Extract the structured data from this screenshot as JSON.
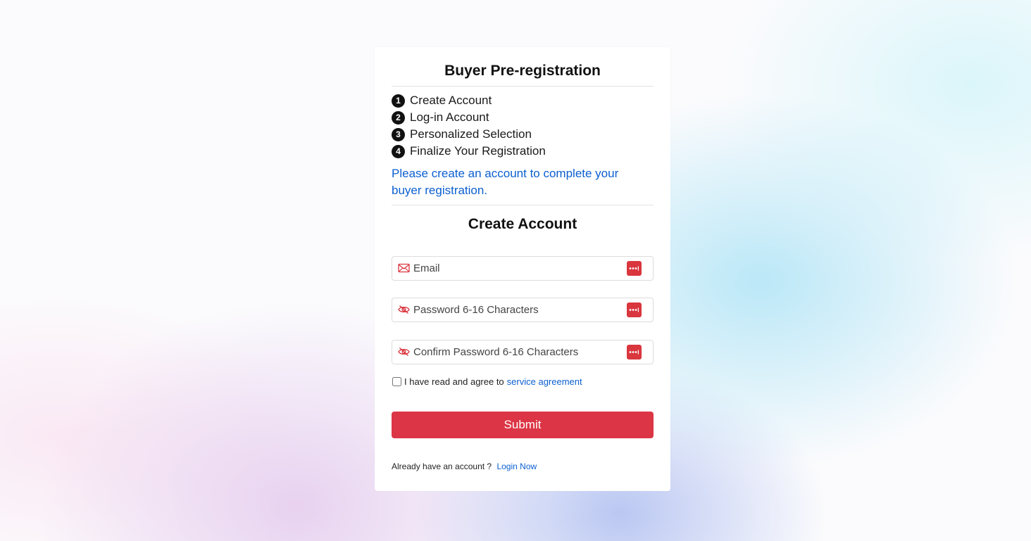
{
  "title": "Buyer Pre-registration",
  "steps": [
    {
      "num": "1",
      "label": "Create Account"
    },
    {
      "num": "2",
      "label": "Log-in Account"
    },
    {
      "num": "3",
      "label": "Personalized Selection"
    },
    {
      "num": "4",
      "label": "Finalize Your Registration"
    }
  ],
  "notice": "Please create an account to complete your buyer registration.",
  "form": {
    "heading": "Create Account",
    "email": {
      "placeholder": "Email",
      "value": "",
      "icon": "envelope-icon"
    },
    "password": {
      "placeholder": "Password 6-16 Characters",
      "value": "",
      "icon": "eye-off-icon"
    },
    "confirm_password": {
      "placeholder": "Confirm Password 6-16 Characters",
      "value": "",
      "icon": "eye-off-icon"
    },
    "password_manager_icon": "password-manager-icon",
    "agree_text": "I have read and agree to",
    "agree_link": "service agreement",
    "agree_checked": false,
    "submit_label": "Submit",
    "login_prompt": "Already have an account ?",
    "login_link": "Login Now"
  },
  "colors": {
    "accent_red": "#dc3545",
    "link_blue": "#0b5fd0",
    "icon_red": "#d9363e"
  }
}
